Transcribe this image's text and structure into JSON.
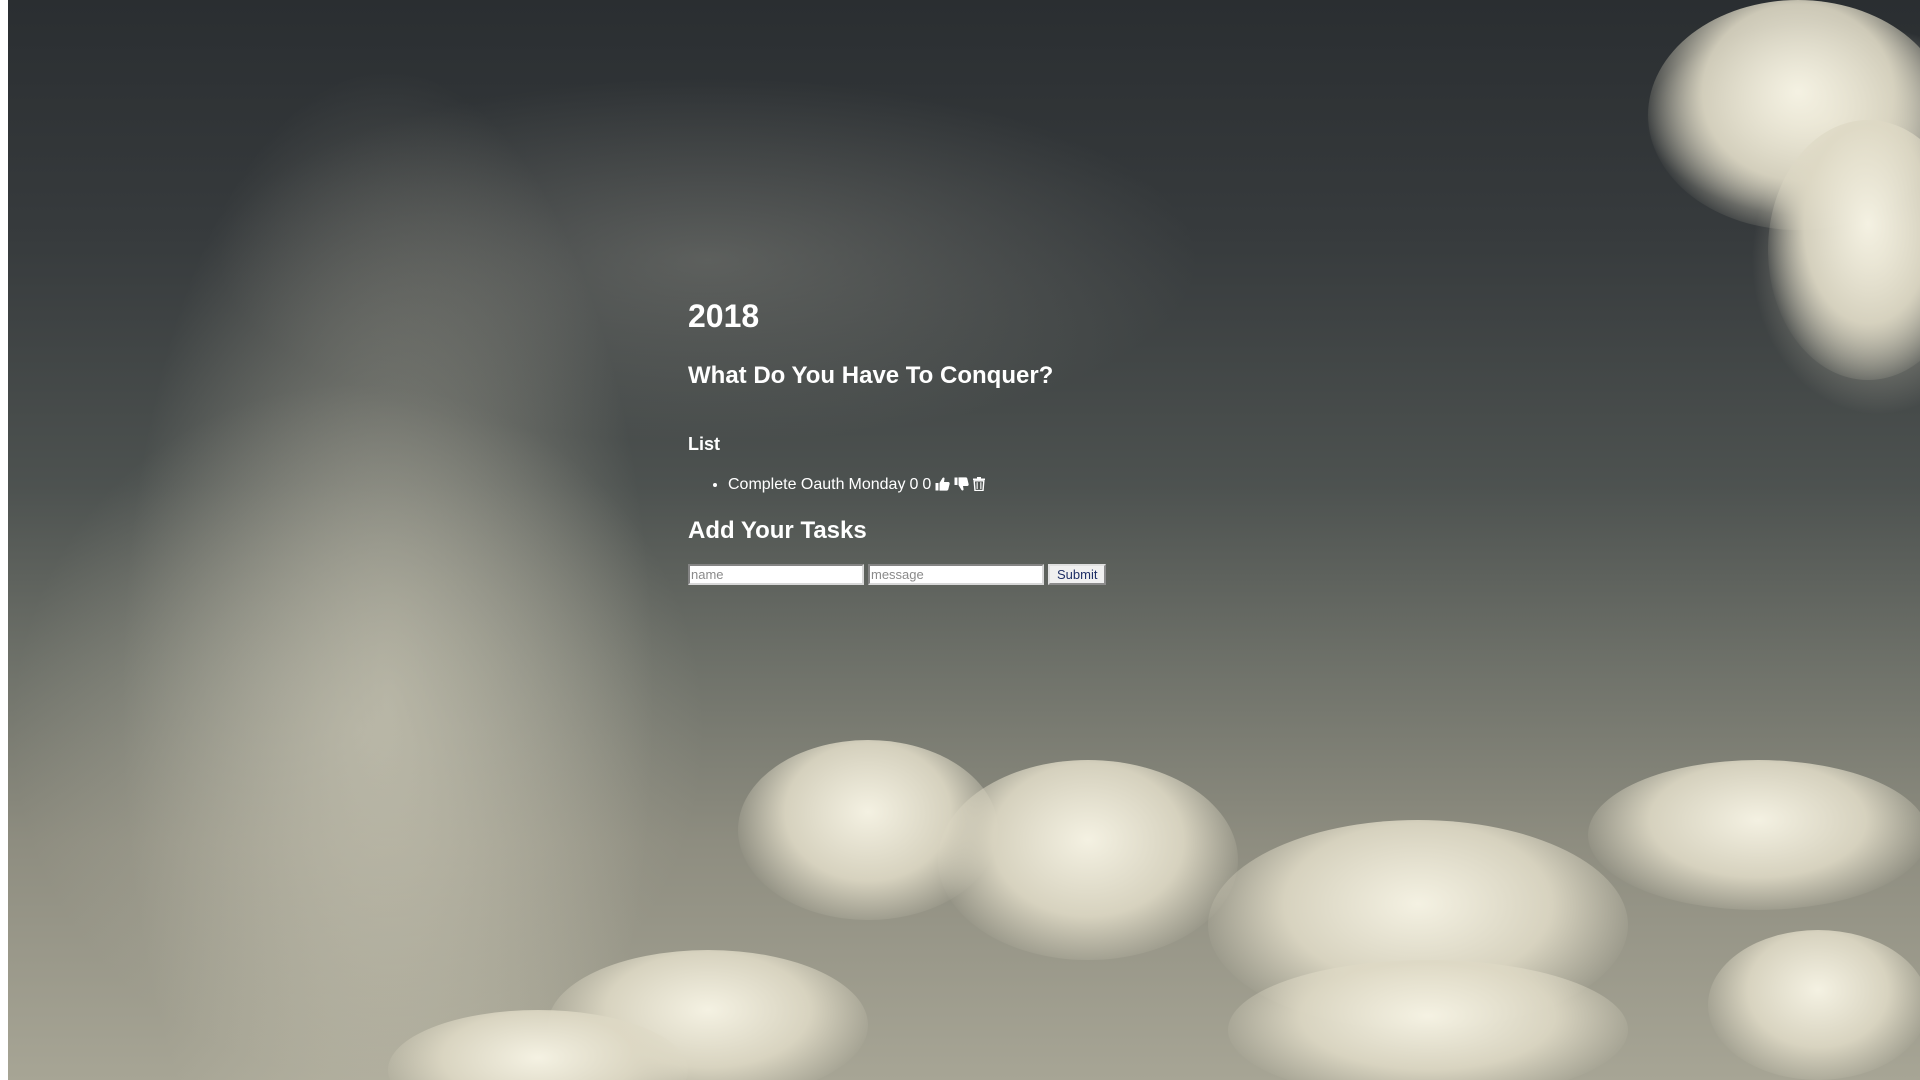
{
  "header": {
    "year": "2018",
    "question": "What Do You Have To Conquer?"
  },
  "list": {
    "title": "List",
    "items": [
      {
        "name": "Complete Oauth",
        "message": "Monday",
        "thumbs_up": "0",
        "thumbs_down": "0",
        "icons": [
          "thumbs-up-icon",
          "thumbs-down-icon",
          "trash-icon"
        ]
      }
    ]
  },
  "add": {
    "title": "Add Your Tasks",
    "name_placeholder": "name",
    "message_placeholder": "message",
    "submit_label": "Submit"
  },
  "colors": {
    "text": "#ffffff",
    "submit_text": "#1f2f66"
  }
}
